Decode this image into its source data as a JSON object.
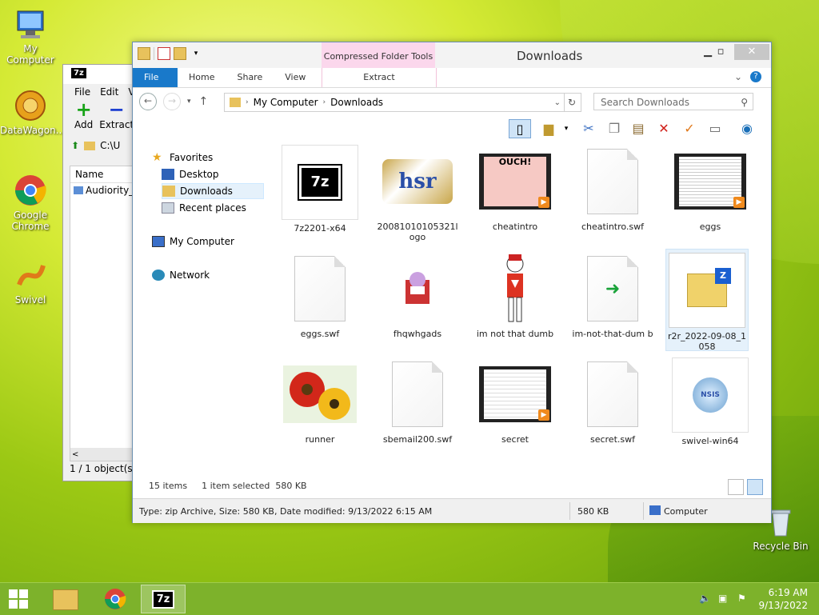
{
  "desktop": {
    "icons": [
      {
        "label": "My Computer"
      },
      {
        "label": "DataWagon..."
      },
      {
        "label": "Google Chrome"
      },
      {
        "label": "Swivel"
      },
      {
        "label": "Recycle Bin"
      }
    ]
  },
  "zip_window": {
    "title_icon": "7z",
    "menu": [
      "File",
      "Edit",
      "V"
    ],
    "tools": [
      {
        "label": "Add"
      },
      {
        "label": "Extract"
      }
    ],
    "address": "C:\\U",
    "column": "Name",
    "row": "Audiority_",
    "status": "1 / 1 object(s)"
  },
  "explorer": {
    "title": "Downloads",
    "context_tab": "Compressed Folder Tools",
    "ribbon_tabs": [
      "File",
      "Home",
      "Share",
      "View"
    ],
    "extract_tab": "Extract",
    "address": {
      "root": "My Computer",
      "current": "Downloads"
    },
    "search_placeholder": "Search Downloads",
    "nav": {
      "favorites": "Favorites",
      "desktop": "Desktop",
      "downloads": "Downloads",
      "recent": "Recent places",
      "computer": "My Computer",
      "network": "Network"
    },
    "files": [
      {
        "name": "7z2201-x64"
      },
      {
        "name": "20081010105321l ogo"
      },
      {
        "name": "cheatintro"
      },
      {
        "name": "cheatintro.swf"
      },
      {
        "name": "eggs"
      },
      {
        "name": "eggs.swf"
      },
      {
        "name": "fhqwhgads"
      },
      {
        "name": "im not that dumb"
      },
      {
        "name": "im-not-that-dum b"
      },
      {
        "name": "r2r_2022-09-08_1 058"
      },
      {
        "name": "runner"
      },
      {
        "name": "sbemail200.swf"
      },
      {
        "name": "secret"
      },
      {
        "name": "secret.swf"
      },
      {
        "name": "swivel-win64"
      }
    ],
    "status": {
      "count": "15 items",
      "selected": "1 item selected  580 KB"
    },
    "details": {
      "info": "Type: zip Archive, Size: 580 KB, Date modified: 9/13/2022 6:15 AM",
      "size": "580 KB",
      "location": "Computer"
    },
    "thumb_texts": {
      "ouch": "OUCH!",
      "hsr": "hsr",
      "sevenz": "7z",
      "zip_z": "Z",
      "nsis": "NSIS"
    }
  },
  "taskbar": {
    "time": "6:19 AM",
    "date": "9/13/2022",
    "tb_7z": "7z"
  },
  "colors": {
    "accent": "#1979ca",
    "taskbar": "#7db22b",
    "context_tab": "#fbd7ec"
  }
}
